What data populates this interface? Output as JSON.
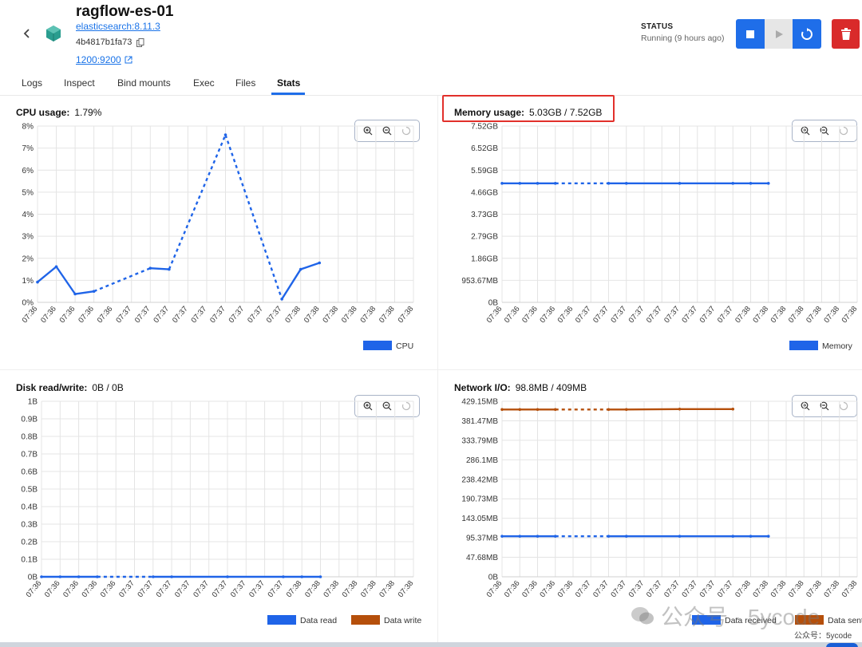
{
  "header": {
    "title": "ragflow-es-01",
    "image": "elasticsearch:8.11.3",
    "container_id": "4b4817b1fa73",
    "port": "1200:9200",
    "status_label": "STATUS",
    "status_value": "Running (9 hours ago)"
  },
  "tabs": [
    {
      "label": "Logs"
    },
    {
      "label": "Inspect"
    },
    {
      "label": "Bind mounts"
    },
    {
      "label": "Exec"
    },
    {
      "label": "Files"
    },
    {
      "label": "Stats"
    }
  ],
  "active_tab": "Stats",
  "colors": {
    "primary": "#1f6ee9",
    "danger": "#d92a2a",
    "series_blue": "#1f64e8",
    "series_orange": "#b54f0b",
    "highlight": "#e2302b"
  },
  "panels": {
    "cpu": {
      "title": "CPU usage:",
      "value": "1.79%"
    },
    "memory": {
      "title": "Memory usage:",
      "value": "5.03GB / 7.52GB"
    },
    "disk": {
      "title": "Disk read/write:",
      "value": "0B / 0B"
    },
    "network": {
      "title": "Network I/O:",
      "value": "98.8MB / 409MB"
    }
  },
  "chart_data": [
    {
      "type": "line",
      "title": "CPU usage",
      "x": [
        "07:36",
        "07:36",
        "07:36",
        "07:36",
        "07:36",
        "07:37",
        "07:37",
        "07:37",
        "07:37",
        "07:37",
        "07:37",
        "07:37",
        "07:37",
        "07:37",
        "07:38",
        "07:38",
        "07:38",
        "07:38",
        "07:38",
        "07:38",
        "07:38"
      ],
      "y_ticks": [
        "0%",
        "1%",
        "2%",
        "3%",
        "4%",
        "5%",
        "6%",
        "7%",
        "8%"
      ],
      "ylim": [
        0,
        8
      ],
      "series": [
        {
          "name": "CPU",
          "color": "#1f64e8",
          "points": [
            [
              0,
              0.92
            ],
            [
              1,
              1.62
            ],
            [
              2,
              0.38
            ],
            [
              3,
              0.5
            ],
            [
              6,
              1.55
            ],
            [
              7,
              1.5
            ],
            [
              10,
              7.6
            ],
            [
              13,
              0.15
            ],
            [
              14,
              1.5
            ],
            [
              15,
              1.79
            ]
          ],
          "dashed_gaps": [
            [
              3,
              6
            ],
            [
              7,
              10
            ],
            [
              10,
              13
            ]
          ]
        }
      ],
      "legend": [
        "CPU"
      ]
    },
    {
      "type": "line",
      "title": "Memory usage",
      "x": [
        "07:36",
        "07:36",
        "07:36",
        "07:36",
        "07:36",
        "07:37",
        "07:37",
        "07:37",
        "07:37",
        "07:37",
        "07:37",
        "07:37",
        "07:37",
        "07:37",
        "07:38",
        "07:38",
        "07:38",
        "07:38",
        "07:38",
        "07:38",
        "07:38"
      ],
      "y_ticks": [
        "0B",
        "953.67MB",
        "1.86GB",
        "2.79GB",
        "3.73GB",
        "4.66GB",
        "5.59GB",
        "6.52GB",
        "7.52GB"
      ],
      "ylim": [
        0,
        8
      ],
      "series": [
        {
          "name": "Memory",
          "color": "#1f64e8",
          "points": [
            [
              0,
              5.4
            ],
            [
              1,
              5.4
            ],
            [
              2,
              5.4
            ],
            [
              3,
              5.4
            ],
            [
              6,
              5.4
            ],
            [
              7,
              5.4
            ],
            [
              10,
              5.4
            ],
            [
              13,
              5.4
            ],
            [
              14,
              5.4
            ],
            [
              15,
              5.4
            ]
          ],
          "dashed_gaps": [
            [
              3,
              6
            ],
            [
              7,
              13
            ]
          ]
        }
      ],
      "legend": [
        "Memory"
      ]
    },
    {
      "type": "line",
      "title": "Disk read/write",
      "x": [
        "07:36",
        "07:36",
        "07:36",
        "07:36",
        "07:36",
        "07:37",
        "07:37",
        "07:37",
        "07:37",
        "07:37",
        "07:37",
        "07:37",
        "07:37",
        "07:37",
        "07:38",
        "07:38",
        "07:38",
        "07:38",
        "07:38",
        "07:38",
        "07:38"
      ],
      "y_ticks": [
        "0B",
        "0.1B",
        "0.2B",
        "0.3B",
        "0.4B",
        "0.5B",
        "0.6B",
        "0.7B",
        "0.8B",
        "0.9B",
        "1B"
      ],
      "ylim": [
        0,
        1
      ],
      "series": [
        {
          "name": "Data read",
          "color": "#1f64e8",
          "points": [
            [
              0,
              0
            ],
            [
              1,
              0
            ],
            [
              2,
              0
            ],
            [
              3,
              0
            ],
            [
              6,
              0
            ],
            [
              7,
              0
            ],
            [
              10,
              0
            ],
            [
              13,
              0
            ],
            [
              14,
              0
            ],
            [
              15,
              0
            ]
          ],
          "dashed_gaps": [
            [
              3,
              6
            ],
            [
              7,
              13
            ]
          ]
        },
        {
          "name": "Data write",
          "color": "#b54f0b",
          "points": [],
          "dashed_gaps": []
        }
      ],
      "legend": [
        "Data read",
        "Data write"
      ]
    },
    {
      "type": "line",
      "title": "Network I/O",
      "x": [
        "07:36",
        "07:36",
        "07:36",
        "07:36",
        "07:36",
        "07:37",
        "07:37",
        "07:37",
        "07:37",
        "07:37",
        "07:37",
        "07:37",
        "07:37",
        "07:37",
        "07:38",
        "07:38",
        "07:38",
        "07:38",
        "07:38",
        "07:38",
        "07:38"
      ],
      "y_ticks": [
        "0B",
        "47.68MB",
        "95.37MB",
        "143.05MB",
        "190.73MB",
        "238.42MB",
        "286.1MB",
        "333.79MB",
        "381.47MB",
        "429.15MB"
      ],
      "ylim": [
        0,
        9
      ],
      "series": [
        {
          "name": "Data received",
          "color": "#1f64e8",
          "points": [
            [
              0,
              2.08
            ],
            [
              1,
              2.08
            ],
            [
              2,
              2.08
            ],
            [
              3,
              2.08
            ],
            [
              6,
              2.08
            ],
            [
              7,
              2.08
            ],
            [
              10,
              2.08
            ],
            [
              13,
              2.08
            ],
            [
              14,
              2.08
            ],
            [
              15,
              2.08
            ]
          ],
          "dashed_gaps": [
            [
              3,
              6
            ],
            [
              7,
              13
            ]
          ]
        },
        {
          "name": "Data sent",
          "color": "#b54f0b",
          "points": [
            [
              0,
              8.58
            ],
            [
              1,
              8.58
            ],
            [
              2,
              8.58
            ],
            [
              3,
              8.58
            ],
            [
              6,
              8.58
            ],
            [
              7,
              8.58
            ],
            [
              10,
              8.6
            ],
            [
              13,
              8.6
            ]
          ],
          "dashed_gaps": [
            [
              3,
              6
            ],
            [
              7,
              13
            ]
          ]
        }
      ],
      "legend": [
        "Data received",
        "Data sent"
      ]
    }
  ],
  "watermark": {
    "text": "公众号 · 5ycode",
    "small": "公众号：5ycode"
  }
}
